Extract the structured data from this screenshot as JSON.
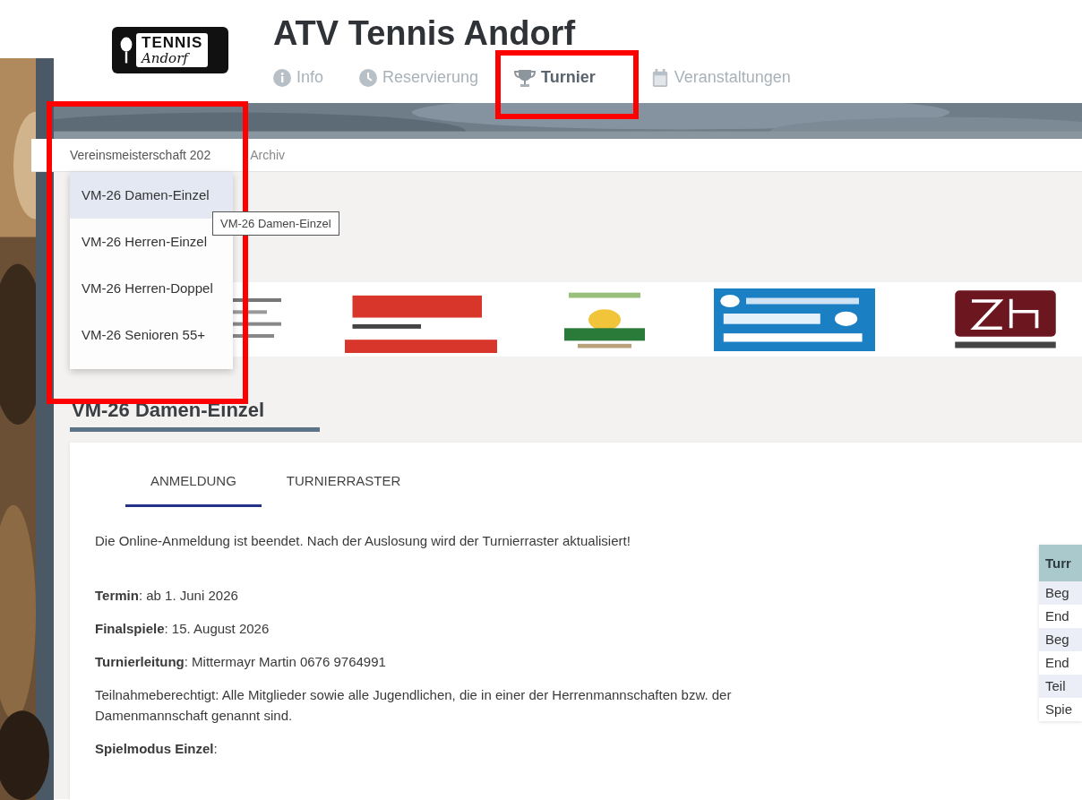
{
  "site": {
    "title": "ATV Tennis Andorf",
    "logo": {
      "line1": "TENNIS",
      "line2": "Andorf"
    }
  },
  "nav": [
    {
      "label": "Info",
      "kind": "info",
      "selected": false
    },
    {
      "label": "Reservierung",
      "kind": "clock",
      "selected": false
    },
    {
      "label": "Turnier",
      "kind": "trophy",
      "selected": true
    },
    {
      "label": "Veranstaltungen",
      "kind": "calendar",
      "selected": false
    }
  ],
  "subnav": [
    {
      "label": "Vereinsmeisterschaft 202",
      "selected": true
    },
    {
      "label": "Archiv",
      "selected": false
    }
  ],
  "dropdown": [
    {
      "label": "VM-26 Damen-Einzel",
      "selected": true
    },
    {
      "label": "VM-26 Herren-Einzel",
      "selected": false
    },
    {
      "label": "VM-26 Herren-Doppel",
      "selected": false
    },
    {
      "label": "VM-26 Senioren 55+",
      "selected": false
    }
  ],
  "tooltip": "VM-26 Damen-Einzel",
  "heading": "VM-26 Damen-Einzel",
  "tabs": [
    {
      "label": "ANMELDUNG",
      "selected": true
    },
    {
      "label": "TURNIERRASTER",
      "selected": false
    }
  ],
  "paragraphs": [
    "Die Online-Anmeldung ist beendet. Nach der Auslosung wird der Turnierraster aktualisiert!",
    "**Termin**: ab 1. Juni 2026",
    "**Finalspiele**: 15. August 2026",
    "**Turnierleitung**: Mittermayr Martin 0676 9764991",
    "Teilnahmeberechtigt: Alle Mitglieder sowie alle Jugendlichen, die in einer der Herrenmannschaften bzw. der Damenmannschaft genannt sind.",
    "**Spielmodus Einzel**:"
  ],
  "info_table": {
    "header": "Turr",
    "rows": [
      "Beg",
      "End",
      "Beg",
      "End",
      "Teil",
      "Spie"
    ]
  }
}
